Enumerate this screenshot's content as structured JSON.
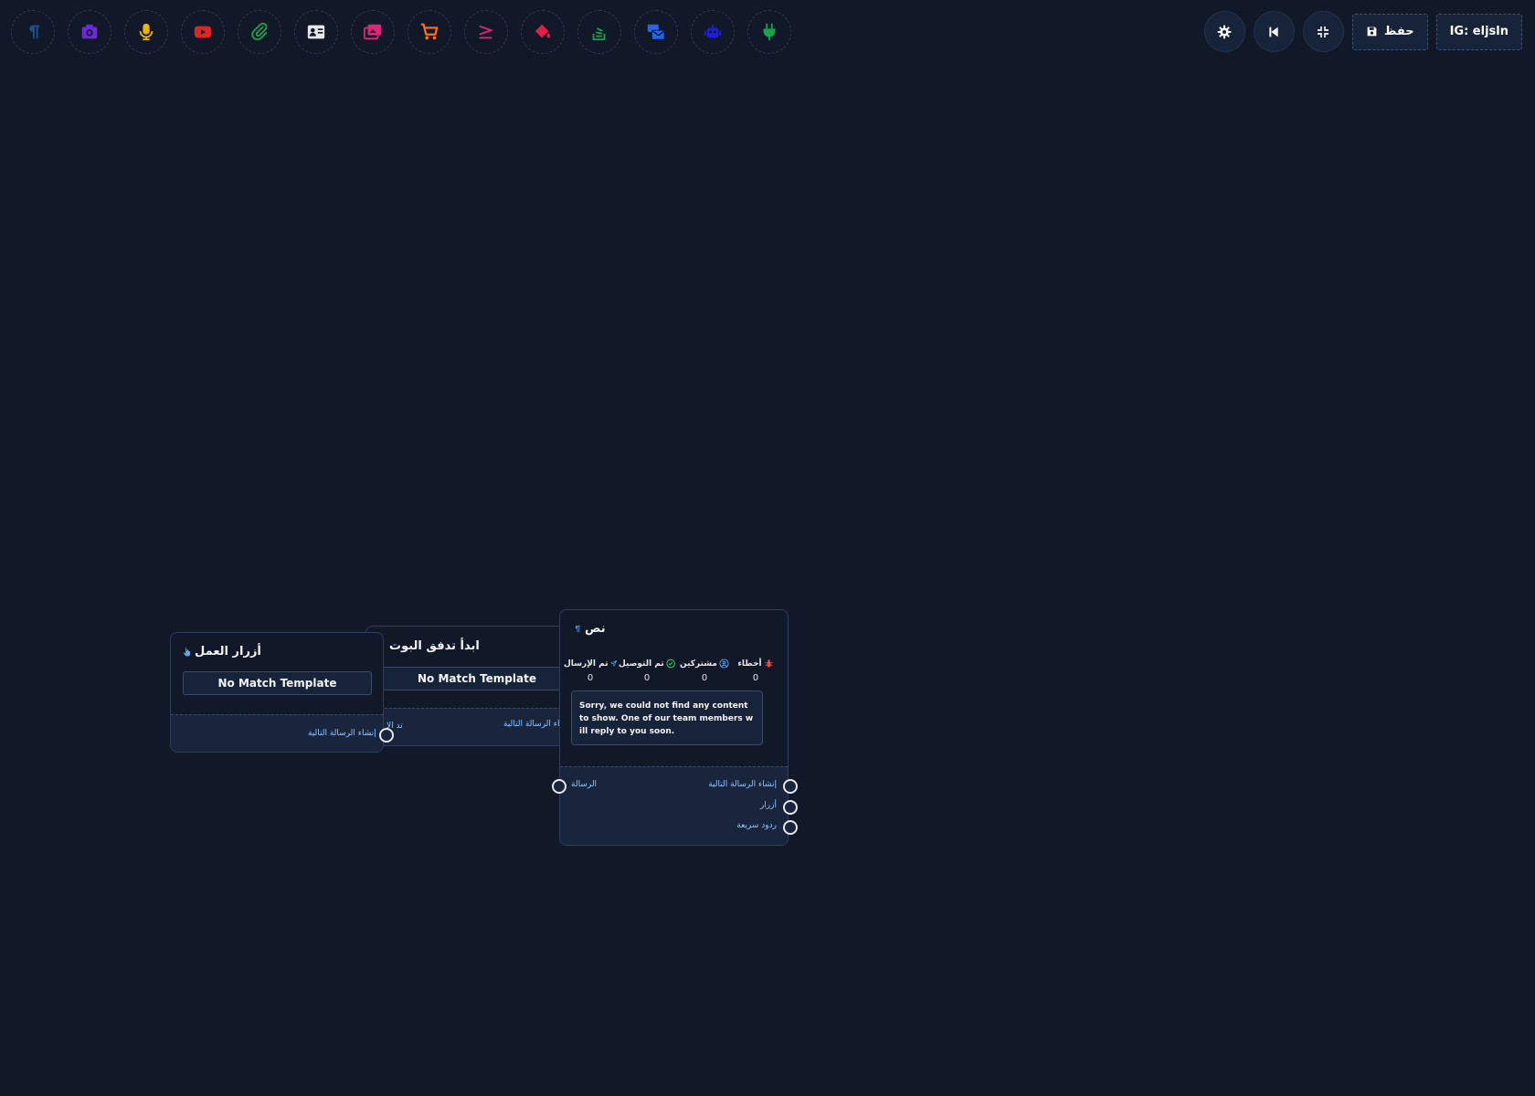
{
  "toolbar": {
    "tools": [
      {
        "icon": "paragraph-icon",
        "color": "#1d4f91"
      },
      {
        "icon": "camera-icon",
        "color": "#6d28d9"
      },
      {
        "icon": "microphone-icon",
        "color": "#eab308"
      },
      {
        "icon": "youtube-icon",
        "color": "#dc2626"
      },
      {
        "icon": "paperclip-icon",
        "color": "#16a34a"
      },
      {
        "icon": "contact-card-icon",
        "color": "#e5e7eb"
      },
      {
        "icon": "images-icon",
        "color": "#db2777"
      },
      {
        "icon": "cart-icon",
        "color": "#f97316"
      },
      {
        "icon": "greater-equal-icon",
        "color": "#db2777"
      },
      {
        "icon": "paint-bucket-icon",
        "color": "#e11d48"
      },
      {
        "icon": "stack-overflow-icon",
        "color": "#16a34a"
      },
      {
        "icon": "mail-bulk-icon",
        "color": "#2563eb"
      },
      {
        "icon": "robot-icon",
        "color": "#1d1dd6"
      },
      {
        "icon": "plug-icon",
        "color": "#16a34a"
      }
    ],
    "save_label": "حفظ",
    "account_label": "IG: eljsln"
  },
  "nodes": {
    "action_buttons": {
      "title": "أزرار العمل",
      "template_button": "No Match Template",
      "output_label": "إنشاء الرسالة التالية"
    },
    "start_flow": {
      "title": "ابدأ تدفق البوت",
      "template_button": "No Match Template",
      "input_label": "تد الإ",
      "output_label": "إنشاء الرسالة التالية"
    },
    "text_node": {
      "title": "نص",
      "stats": [
        {
          "label": "أخطاء",
          "value": "0",
          "icon": "bug-icon",
          "color": "#ef4444"
        },
        {
          "label": "مشتركين",
          "value": "0",
          "icon": "user-circle-icon",
          "color": "#60a5fa"
        },
        {
          "label": "تم التوصيل",
          "value": "0",
          "icon": "check-circle-icon",
          "color": "#4ade80"
        },
        {
          "label": "تم الإرسال",
          "value": "0",
          "icon": "paper-plane-icon",
          "color": "#60a5fa"
        }
      ],
      "message": "Sorry, we could not find any content to show. One of our team members will reply to you soon.",
      "input_label": "الرسالة",
      "outputs": [
        "إنشاء الرسالة التالية",
        "أزرار",
        "ردود سريعة"
      ]
    }
  }
}
